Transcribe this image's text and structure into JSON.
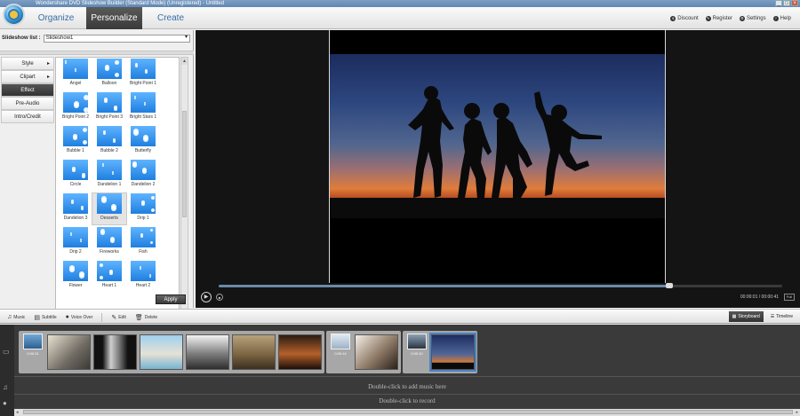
{
  "window": {
    "title": "Wondershare DVD Slideshow Builder (Standard Mode) (Unregistered) - Untitled",
    "buttons": [
      "_",
      "□",
      "×"
    ]
  },
  "header": {
    "tabs": [
      {
        "label": "Organize",
        "active": false
      },
      {
        "label": "Personalize",
        "active": true
      },
      {
        "label": "Create",
        "active": false
      }
    ],
    "links": [
      {
        "label": "Discount",
        "icon": "tag-icon"
      },
      {
        "label": "Register",
        "icon": "key-icon"
      },
      {
        "label": "Settings",
        "icon": "gear-icon"
      },
      {
        "label": "Help",
        "icon": "help-icon"
      }
    ]
  },
  "left": {
    "slideshow_label": "Slideshow list :",
    "slideshow_value": "Slideshow1",
    "categories": [
      {
        "label": "Style",
        "arrow": true,
        "active": false
      },
      {
        "label": "Clipart",
        "arrow": true,
        "active": false
      },
      {
        "label": "Effect",
        "arrow": false,
        "active": true
      },
      {
        "label": "Pre-Audio",
        "arrow": false,
        "active": false
      },
      {
        "label": "Intro/Credit",
        "arrow": false,
        "active": false
      }
    ],
    "effects": [
      "Angel",
      "Balloon",
      "Bright Point 1",
      "Bright Point 2",
      "Bright Point 3",
      "Bright Stars 1",
      "Bubble 1",
      "Bubble 2",
      "Butterfly",
      "Circle",
      "Dandelion 1",
      "Dandelion 2",
      "Dandelion 3",
      "Desserts",
      "Drip 1",
      "Drip 2",
      "Fireworks",
      "Fish",
      "Flower",
      "Heart 1",
      "Heart 2"
    ],
    "selected_effect": "Desserts",
    "apply_label": "Apply"
  },
  "player": {
    "time": "00:00:01 / 00:00:41",
    "fullscreen_label": "Full",
    "progress": 0.8
  },
  "toolbar": {
    "items": [
      {
        "label": "Music",
        "icon": "music-icon"
      },
      {
        "label": "Subtitle",
        "icon": "subtitle-icon"
      },
      {
        "label": "Voice Over",
        "icon": "microphone-icon"
      },
      {
        "label": "Edit",
        "icon": "pencil-icon"
      },
      {
        "label": "Delete",
        "icon": "trash-icon"
      }
    ],
    "views": [
      {
        "label": "Storyboard",
        "active": true
      },
      {
        "label": "Timeline",
        "active": false
      }
    ]
  },
  "timeline": {
    "groups": [
      {
        "duration": "0:00:21",
        "clips": 6
      },
      {
        "duration": "0:00:14",
        "clips": 1
      },
      {
        "duration": "0:00:10",
        "clips": 1
      }
    ],
    "music_hint": "Double-click to add music here",
    "record_hint": "Double-click to record"
  }
}
